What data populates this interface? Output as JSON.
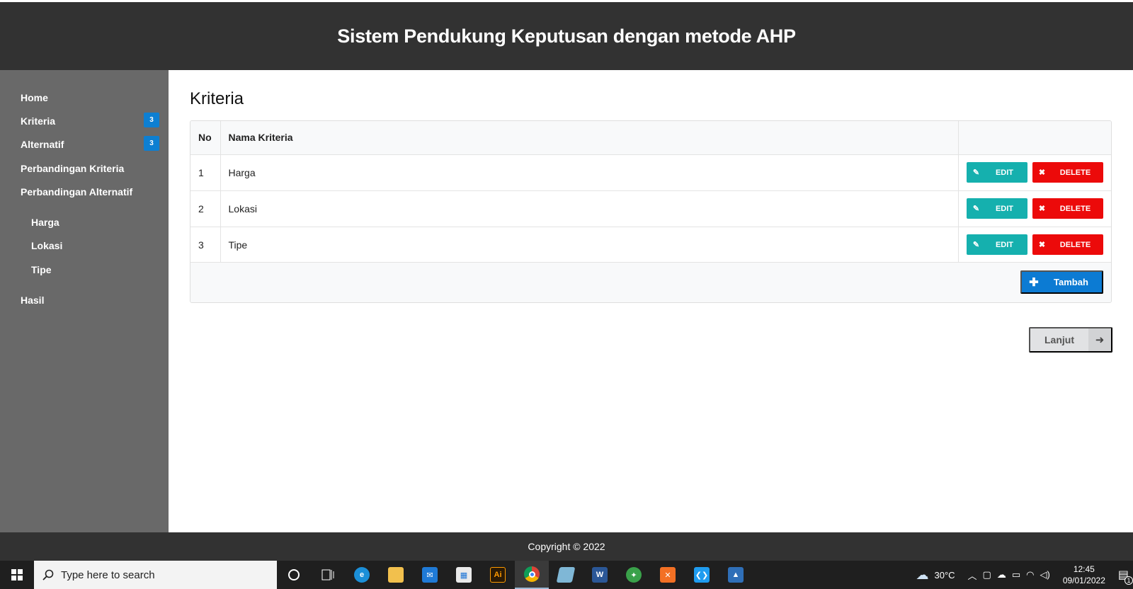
{
  "app": {
    "title": "Sistem Pendukung Keputusan dengan metode AHP"
  },
  "sidebar": {
    "items": [
      {
        "label": "Home"
      },
      {
        "label": "Kriteria",
        "badge": "3"
      },
      {
        "label": "Alternatif",
        "badge": "3"
      },
      {
        "label": "Perbandingan Kriteria"
      },
      {
        "label": "Perbandingan Alternatif"
      }
    ],
    "subitems": [
      {
        "label": "Harga"
      },
      {
        "label": "Lokasi"
      },
      {
        "label": "Tipe"
      }
    ],
    "hasil": {
      "label": "Hasil"
    }
  },
  "main": {
    "title": "Kriteria",
    "table": {
      "headers": {
        "no": "No",
        "name": "Nama Kriteria"
      },
      "rows": [
        {
          "no": "1",
          "name": "Harga"
        },
        {
          "no": "2",
          "name": "Lokasi"
        },
        {
          "no": "3",
          "name": "Tipe"
        }
      ],
      "edit_label": "EDIT",
      "delete_label": "DELETE"
    },
    "add_label": "Tambah",
    "next_label": "Lanjut"
  },
  "footer": {
    "text": "Copyright © 2022"
  },
  "taskbar": {
    "search_placeholder": "Type here to search",
    "apps": [
      {
        "icon": "cortana-icon"
      },
      {
        "icon": "task-view-icon"
      },
      {
        "icon": "edge-icon"
      },
      {
        "icon": "file-explorer-icon"
      },
      {
        "icon": "mail-icon"
      },
      {
        "icon": "store-icon"
      },
      {
        "icon": "illustrator-icon",
        "text": "Ai"
      },
      {
        "icon": "chrome-icon"
      },
      {
        "icon": "notes-icon"
      },
      {
        "icon": "word-icon",
        "text": "W"
      },
      {
        "icon": "app-icon"
      },
      {
        "icon": "xampp-icon"
      },
      {
        "icon": "vscode-icon"
      },
      {
        "icon": "photos-icon"
      }
    ],
    "weather": "30°C",
    "time": "12:45",
    "date": "09/01/2022",
    "notifications": "1"
  },
  "colors": {
    "header_bg": "#323232",
    "sidebar_bg": "#696969",
    "edit": "#15b0ae",
    "delete": "#ec0a0a",
    "primary": "#0c7bd3"
  }
}
